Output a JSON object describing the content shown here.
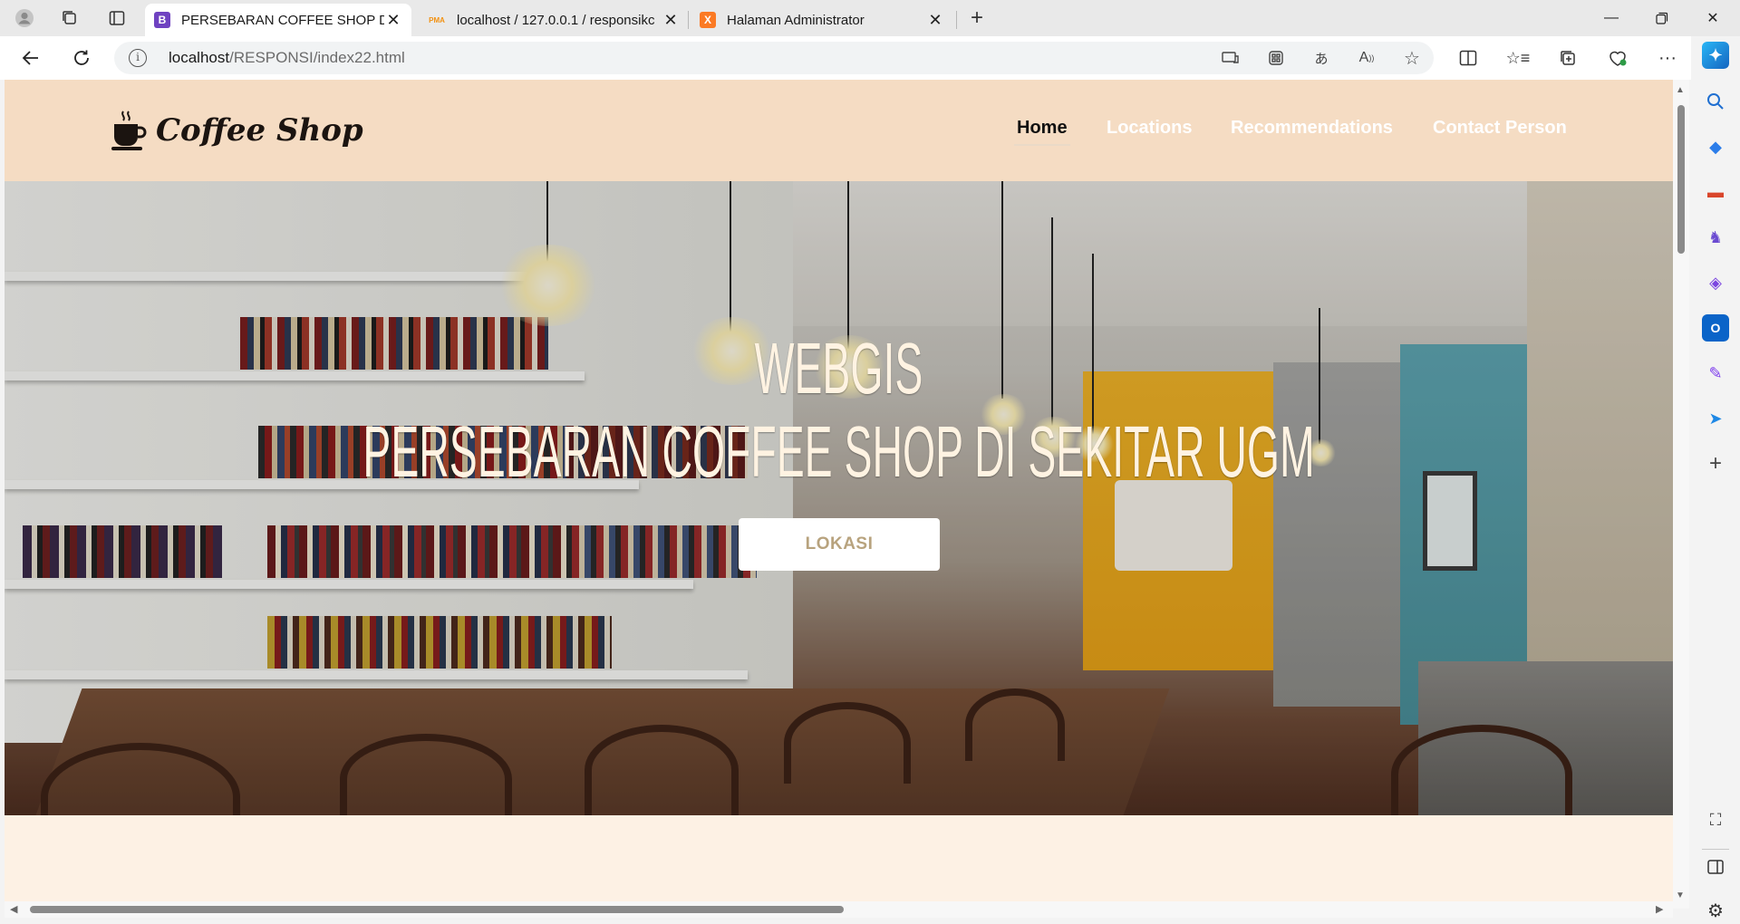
{
  "browser": {
    "tabs": [
      {
        "title": "PERSEBARAN COFFEE SHOP DI S",
        "favicon": "B",
        "favicon_color": "#6f42c1",
        "active": true
      },
      {
        "title": "localhost / 127.0.0.1 / responsikc",
        "favicon": "PMA",
        "favicon_color": "#f29111",
        "active": false
      },
      {
        "title": "Halaman Administrator",
        "favicon": "X",
        "favicon_color": "#fb7a24",
        "active": false
      }
    ],
    "address": {
      "host": "localhost",
      "path": "/RESPONSI/index22.html"
    }
  },
  "site": {
    "brand": "Coffee Shop",
    "menu": [
      "Home",
      "Locations",
      "Recommendations",
      "Contact Person"
    ],
    "hero": {
      "title_line1": "WEBGIS",
      "title_line2": "PERSEBARAN COFFEE SHOP DI SEKITAR UGM",
      "button": "LOKASI"
    },
    "colors": {
      "nav_bg": "#f5dcc3",
      "page_bg": "#fdf1e4",
      "button_text": "#b8a37e"
    }
  }
}
